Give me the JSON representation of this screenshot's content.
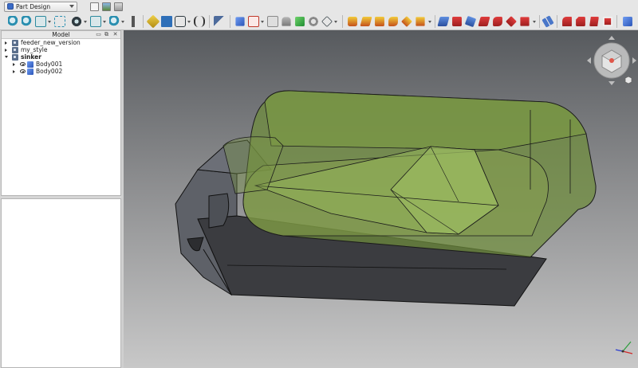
{
  "app": {
    "workbench": "Part Design"
  },
  "colors": {
    "toolbar_bg": "#e6e6e6",
    "viewport_top": "#575a5e",
    "viewport_bottom": "#c8c8c8",
    "solid_gray": "#3f4044",
    "transparent_green": "#6d8c3c"
  },
  "model_panel": {
    "title": "Model",
    "tree": [
      {
        "label": "feeder_new_version",
        "expanded": false,
        "icon": "document-icon"
      },
      {
        "label": "my_style",
        "expanded": false,
        "icon": "document-icon"
      },
      {
        "label": "sinker",
        "expanded": true,
        "bold": true,
        "icon": "document-icon",
        "children": [
          {
            "label": "Body001",
            "visible": true,
            "icon": "body-icon"
          },
          {
            "label": "Body002",
            "visible": true,
            "icon": "body-icon"
          }
        ]
      }
    ]
  },
  "toolbar_icons": [
    "new-file-icon",
    "open-file-icon",
    "save-icon",
    "fit-all-icon",
    "fit-selection-icon",
    "std-views-icon",
    "select-box-icon",
    "draw-style-icon",
    "view-iso-icon",
    "zoom-icon",
    "measure-icon",
    "whats-this-icon",
    "part-icon",
    "group-icon",
    "link-icon",
    "expression-icon",
    "sketch-icon",
    "body-icon",
    "create-sketch-icon",
    "validate-sketch-icon",
    "datum-icon",
    "shape-binder-icon",
    "clone-icon",
    "sub-shape-binder-icon",
    "pad-icon",
    "revolution-icon",
    "loft-icon",
    "pipe-icon",
    "helix-icon",
    "additive-primitive-icon",
    "pocket-icon",
    "hole-icon",
    "groove-icon",
    "subtractive-loft-icon",
    "subtractive-pipe-icon",
    "subtractive-primitive-icon",
    "mirrored-icon",
    "fillet-icon",
    "chamfer-icon",
    "draft-icon",
    "thickness-icon",
    "boolean-icon"
  ]
}
